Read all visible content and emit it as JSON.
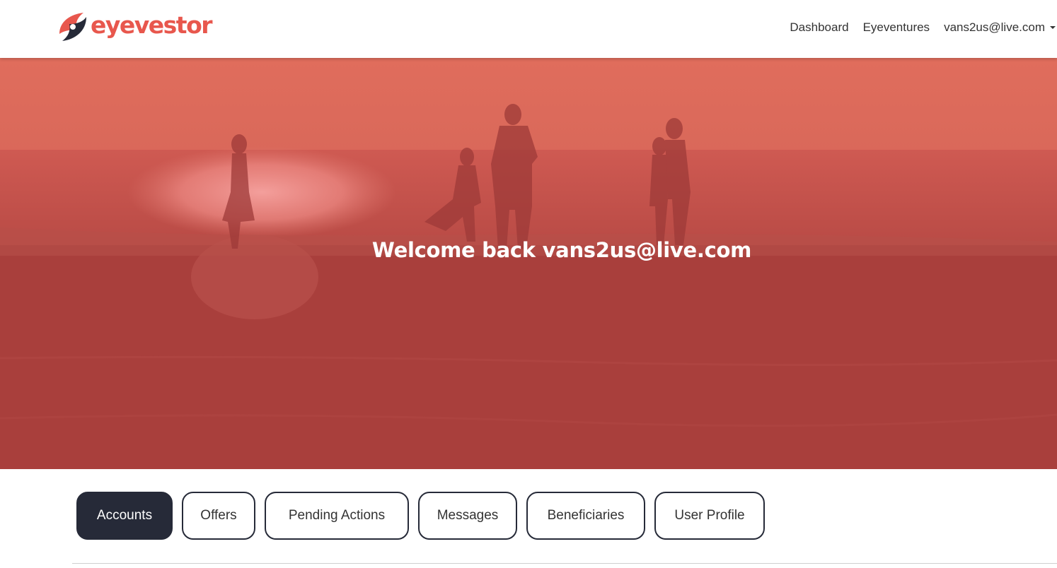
{
  "header": {
    "brand": "eyevestor",
    "nav": {
      "dashboard": "Dashboard",
      "eyeventures": "Eyeventures",
      "user": "vans2us@live.com"
    }
  },
  "hero": {
    "title": "Welcome back vans2us@live.com"
  },
  "tabs": [
    {
      "label": "Accounts",
      "active": true
    },
    {
      "label": "Offers",
      "active": false
    },
    {
      "label": "Pending Actions",
      "active": false
    },
    {
      "label": "Messages",
      "active": false
    },
    {
      "label": "Beneficiaries",
      "active": false
    },
    {
      "label": "User Profile",
      "active": false
    }
  ],
  "colors": {
    "brand": "#e8574d",
    "dark": "#262a38",
    "hero_overlay": "#c8453f"
  }
}
